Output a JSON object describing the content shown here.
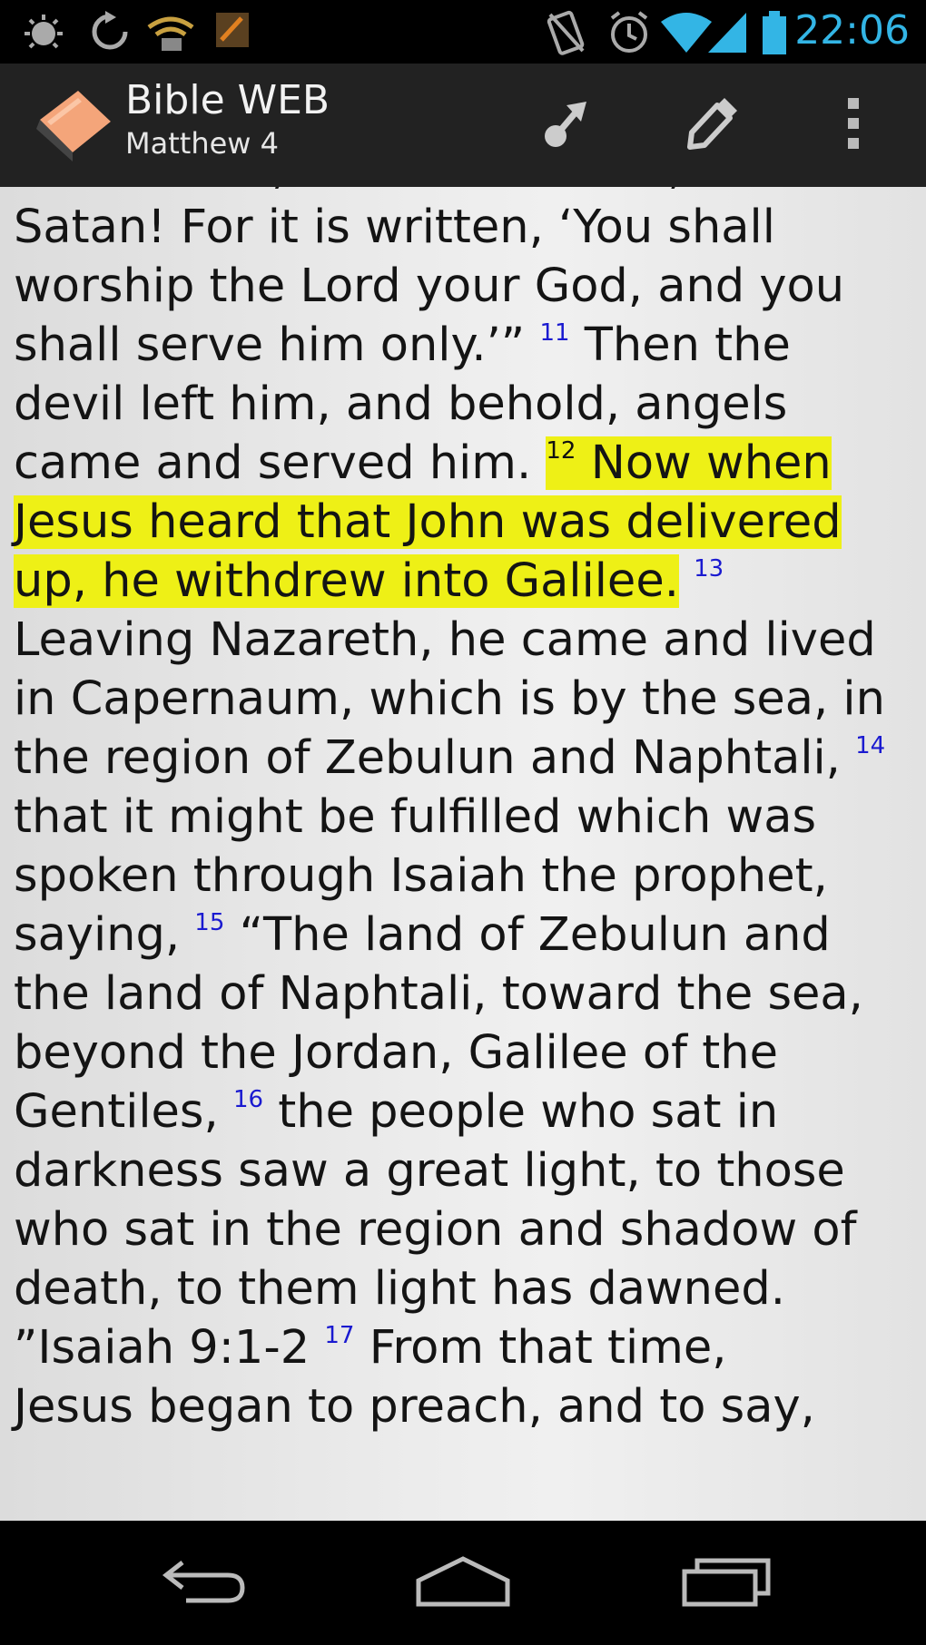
{
  "status_bar": {
    "time": "22:06",
    "icons": [
      "debug-icon",
      "sync-icon",
      "wifi-hotspot-icon",
      "app-notification-icon",
      "no-sim-icon",
      "alarm-icon",
      "wifi-icon",
      "signal-icon",
      "battery-icon"
    ],
    "accent": "#33b5e5"
  },
  "action_bar": {
    "title": "Bible WEB",
    "subtitle": "Matthew 4",
    "actions": [
      "share-icon",
      "edit-icon",
      "overflow-menu-icon"
    ]
  },
  "passage": {
    "partial_top": "said to him, “Get behind me,",
    "s1": "Satan! For it is written, ‘You shall worship the Lord your God, and you shall serve him only.’” ",
    "v11": "11",
    "s2": " Then the devil left him, and behold, angels came and served him. ",
    "v12": "12",
    "s3": "Now when Jesus heard that John was delivered up, he withdrew into Galilee.",
    "v13": "13",
    "s4": " Leaving Nazareth, he came and lived in Capernaum, which is by the sea, in the region of Zebulun and Naphtali, ",
    "v14": "14",
    "s5": " that it might be fulfilled which was spoken through Isaiah the prophet, saying, ",
    "v15": "15",
    "s6": " “The land of Zebulun and the land of Naphtali, toward the sea, beyond the Jordan, Galilee of the Gentiles, ",
    "v16": "16",
    "s7": " the people who sat in darkness saw a great light, to those who sat in the region and shadow of death, to them light has dawned. ”Isaiah 9:1-2 ",
    "v17": "17",
    "s8": " From that time,",
    "partial_bottom": "Jesus began to preach, and to say,",
    "highlight_color": "#eef016",
    "verse_number_color": "#1a1ad0"
  },
  "nav_bar": {
    "buttons": [
      "back-icon",
      "home-icon",
      "recent-apps-icon"
    ]
  }
}
